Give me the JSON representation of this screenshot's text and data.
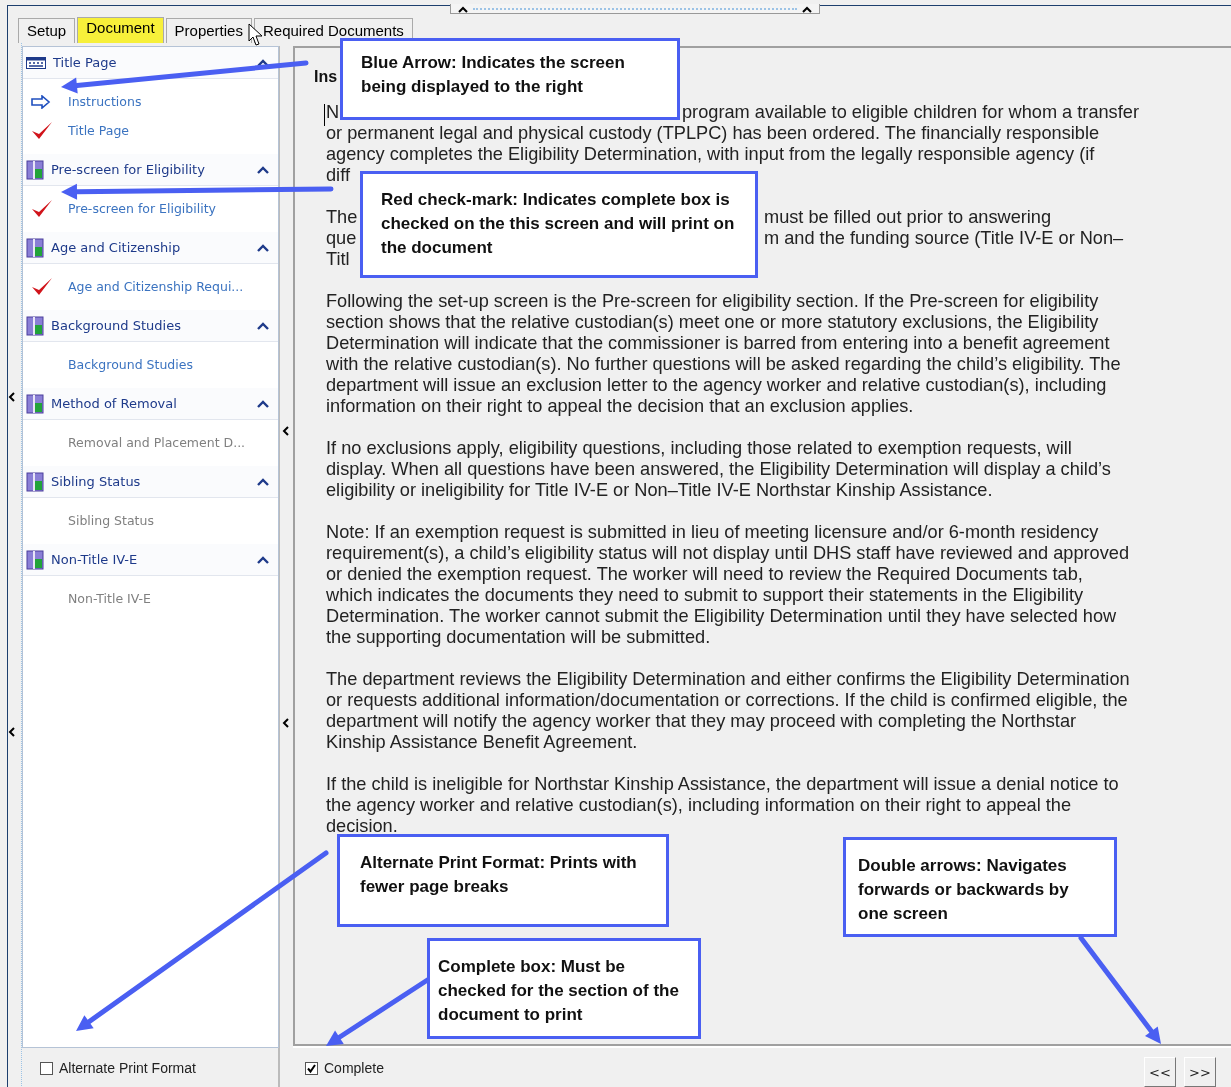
{
  "tabs": [
    {
      "label": "Setup",
      "selected": false
    },
    {
      "label": "Document",
      "selected": true
    },
    {
      "label": "Properties",
      "selected": false
    },
    {
      "label": "Required Documents",
      "selected": false
    }
  ],
  "outline": [
    {
      "title": "Title Page",
      "kind": "page",
      "expanded": true,
      "children": [
        {
          "label": "Instructions",
          "current": true,
          "complete": false,
          "disabled": false
        },
        {
          "label": "Title Page",
          "current": false,
          "complete": true,
          "disabled": false
        }
      ]
    },
    {
      "title": "Pre-screen for Eligibility",
      "kind": "section",
      "expanded": true,
      "children": [
        {
          "label": "Pre-screen for Eligibility",
          "current": false,
          "complete": true,
          "disabled": false
        }
      ]
    },
    {
      "title": "Age and Citizenship",
      "kind": "section",
      "expanded": true,
      "children": [
        {
          "label": "Age and Citizenship Requi...",
          "current": false,
          "complete": true,
          "disabled": false
        }
      ]
    },
    {
      "title": "Background Studies",
      "kind": "section",
      "expanded": true,
      "children": [
        {
          "label": "Background Studies",
          "current": false,
          "complete": false,
          "disabled": false
        }
      ]
    },
    {
      "title": "Method of Removal",
      "kind": "section",
      "expanded": true,
      "children": [
        {
          "label": "Removal and Placement D...",
          "current": false,
          "complete": false,
          "disabled": true
        }
      ]
    },
    {
      "title": "Sibling Status",
      "kind": "section",
      "expanded": true,
      "children": [
        {
          "label": "Sibling Status",
          "current": false,
          "complete": false,
          "disabled": true
        }
      ]
    },
    {
      "title": "Non-Title IV-E",
      "kind": "section",
      "expanded": true,
      "children": [
        {
          "label": "Non-Title IV-E",
          "current": false,
          "complete": false,
          "disabled": true
        }
      ]
    }
  ],
  "content": {
    "heading": "Ins",
    "partial_paragraphs": [
      {
        "kind": "short-gap",
        "lines": [
          {
            "start": "N",
            "rest": "program available to eligible children for whom a transfer"
          },
          {
            "start": "or permanent legal and physical custody (TPLPC) has been ordered. The financially responsible"
          },
          {
            "start": "agency completes the Eligibility Determination, with input from the legally responsible agency (if"
          },
          {
            "start": "diff"
          }
        ]
      },
      {
        "kind": "long-gap",
        "lines": [
          {
            "start": "The",
            "rest": "must be filled out prior to answering"
          },
          {
            "start": "que",
            "rest": "m and the funding source (Title IV-E or Non–"
          },
          {
            "start": "Titl"
          }
        ]
      }
    ],
    "paragraphs": [
      "Following the set-up screen is the Pre-screen for eligibility section. If the Pre-screen for eligibility section shows that the relative custodian(s) meet one or more statutory exclusions, the Eligibility Determination will indicate that the commissioner is barred from entering into a benefit agreement with the relative custodian(s). No further questions will be asked regarding the child’s eligibility. The department will issue an exclusion letter to the agency worker and relative custodian(s), including information on their right to appeal the decision that an exclusion applies.",
      "If no exclusions apply, eligibility questions, including those related to exemption requests, will display. When all questions have been answered, the Eligibility Determination will display a child’s eligibility or ineligibility for Title IV-E or Non–Title IV-E Northstar Kinship Assistance.",
      "Note: If an exemption request is submitted in lieu of meeting licensure and/or 6-month residency requirement(s), a child’s eligibility status will not display until DHS staff have reviewed and approved or denied the exemption request. The worker will need to review the Required Documents tab, which indicates the documents they need to submit to support their statements in the Eligibility Determination. The worker cannot submit the Eligibility Determination until they have selected how the supporting documentation will be submitted.",
      "The department reviews the Eligibility Determination and either confirms the Eligibility Determination or requests additional information/documentation or corrections. If the child is confirmed eligible, the department will notify the agency worker that they may proceed with completing the Northstar Kinship Assistance Benefit Agreement.",
      "If the child is ineligible for Northstar Kinship Assistance, the department will issue a denial notice to the agency worker and relative custodian(s), including information on their right to appeal the decision."
    ]
  },
  "footer": {
    "alternate_print": {
      "label": "Alternate Print Format",
      "checked": false
    },
    "complete": {
      "label": "Complete",
      "checked": true
    },
    "nav_buttons": [
      "<<",
      ">>"
    ]
  },
  "callouts": [
    "Blue Arrow: Indicates the screen being displayed to the right",
    "Red check-mark: Indicates complete box is checked on the this screen and will print on the document",
    "Alternate Print Format: Prints with fewer page breaks",
    "Complete box: Must be checked for the section of the document to print",
    "Double arrows: Navigates forwards or backwards by one screen"
  ]
}
